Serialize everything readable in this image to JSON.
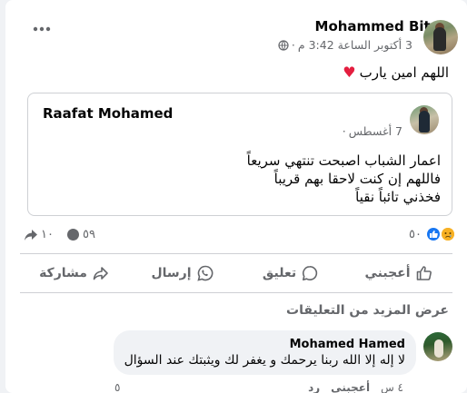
{
  "post": {
    "author": "Mohammed Bito",
    "timestamp": "3 أكتوبر الساعة 3:42 م",
    "privacy_sep": "·",
    "privacy_icon": "globe-icon",
    "more_icon": "more-horizontal-icon",
    "text": "اللهم امين يارب",
    "text_emoji": "♥"
  },
  "shared_post": {
    "author": "Raafat Mohamed",
    "timestamp": "7 أغسطس",
    "privacy_sep": "·",
    "lines": [
      "اعمار الشباب اصبحت تنتهي سريعاً",
      "فاللهم إن كنت لاحقا بهم قريباً",
      "فخذني تائباً نقياً"
    ]
  },
  "stats": {
    "reactions_count": "٥٠",
    "comments_count": "٥٩",
    "shares_count": "١٠"
  },
  "actions": {
    "like": "أعجبني",
    "comment": "تعليق",
    "send": "إرسال",
    "share": "مشاركة"
  },
  "comments": {
    "view_more": "عرض المزيد من التعليقات",
    "items": [
      {
        "author": "Mohamed Hamed",
        "text": "لا إله إلا الله ربنا يرحمك و يغفر لك ويثبتك عند السؤال",
        "age": "٤ س",
        "like": "أعجبني",
        "reply": "رد",
        "reactions": "٥"
      }
    ]
  },
  "colors": {
    "heart": "#e41e3f",
    "like_blue": "#1877f2",
    "secondary_text": "#65676b"
  }
}
